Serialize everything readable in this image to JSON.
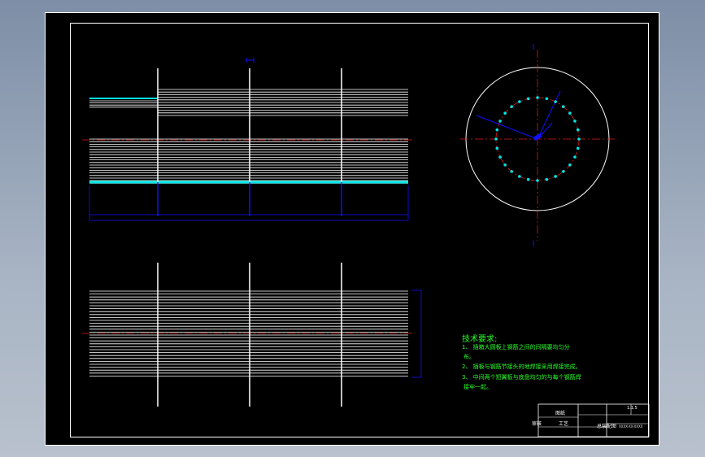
{
  "technical_requirements": {
    "title": "技术要求:",
    "items": [
      "1、 插箱大圆板上钢筋之间的间隔要均匀分",
      "布。",
      "2、 插板与钢筋节接头的地焊接采用焊接完成。",
      "3、 中间两个短翼板与底盘均匀的与每个钢筋焊",
      "接牢一起。"
    ]
  },
  "title_block": {
    "name": "图纸",
    "approve": "审核",
    "craft": "工艺",
    "title": "总装配图",
    "scale": "1:1.5",
    "code": "XXXX-XX-XXXX"
  },
  "colors": {
    "background": "#000000",
    "lines": "#ffffff",
    "centerline": "#e01818",
    "dimension": "#1010ff",
    "highlight": "#00e5e5",
    "text": "#28ff28"
  }
}
